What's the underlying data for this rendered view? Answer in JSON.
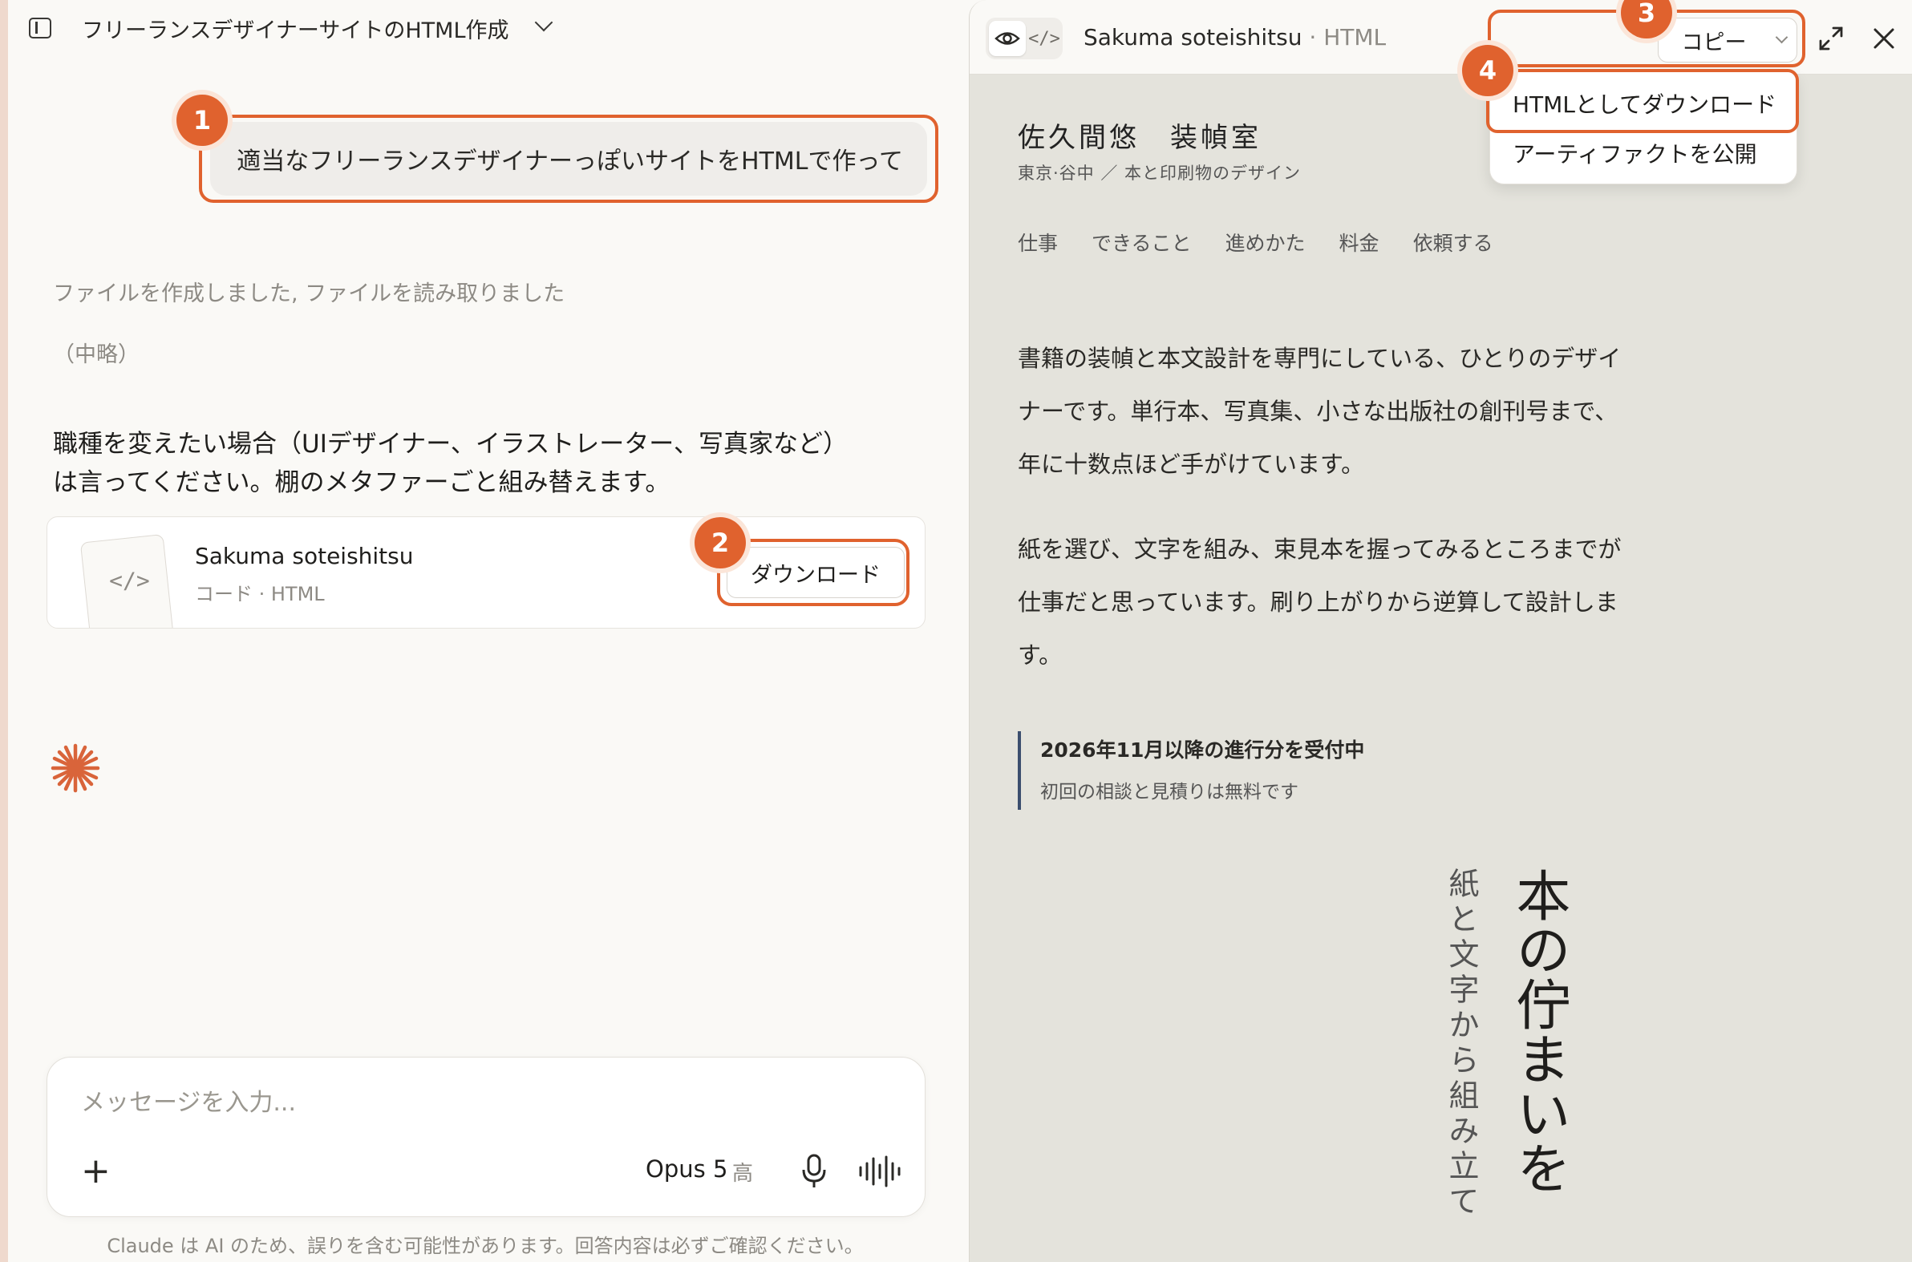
{
  "header": {
    "chat_title": "フリーランスデザイナーサイトのHTML作成"
  },
  "chat": {
    "user_message": "適当なフリーランスデザイナーっぽいサイトをHTMLで作って",
    "tool_status": "ファイルを作成しました, ファイルを読み取りました",
    "omitted": "（中略）",
    "assistant_message_line1": "職種を変えたい場合（UIデザイナー、イラストレーター、写真家など）",
    "assistant_message_line2": "は言ってください。棚のメタファーごと組み替えます。",
    "artifact_card": {
      "name": "Sakuma soteishitsu",
      "subtitle": "コード · HTML",
      "thumb_icon": "</>",
      "download_label": "ダウンロード"
    }
  },
  "composer": {
    "placeholder": "メッセージを入力...",
    "plus": "+",
    "model": "Opus 5",
    "effort": "高"
  },
  "disclaimer": "Claude は AI のため、誤りを含む可能性があります。回答内容は必ずご確認ください。",
  "panel": {
    "title": "Sakuma soteishitsu",
    "title_sep": " · ",
    "title_kind": "HTML",
    "code_toggle": "</>",
    "copy_label": "コピー",
    "menu": {
      "download_html": "HTMLとしてダウンロード",
      "publish": "アーティファクトを公開"
    }
  },
  "site": {
    "brand": "佐久間悠　装幀室",
    "tagline": "東京·谷中 ／ 本と印刷物のデザイン",
    "nav": [
      "仕事",
      "できること",
      "進めかた",
      "料金",
      "依頼する"
    ],
    "intro_1": "書籍の装幀と本文設計を専門にしている、ひとりのデザイナーです。単行本、写真集、小さな出版社の創刊号まで、年に十数点ほど手がけています。",
    "intro_2": "紙を選び、文字を組み、束見本を握ってみるところまでが仕事だと思っています。刷り上がりから逆算して設計します。",
    "notice_head": "2026年11月以降の進行分を受付中",
    "notice_sub": "初回の相談と見積りは無料です",
    "vertical_big": "本の佇まいを",
    "vertical_small": "紙と文字から組み立て"
  },
  "annotations": [
    "1",
    "2",
    "3",
    "4"
  ],
  "colors": {
    "accent": "#e0622e",
    "notice_bar": "#3b4e6e",
    "panel_bg": "#e4e3dc"
  }
}
